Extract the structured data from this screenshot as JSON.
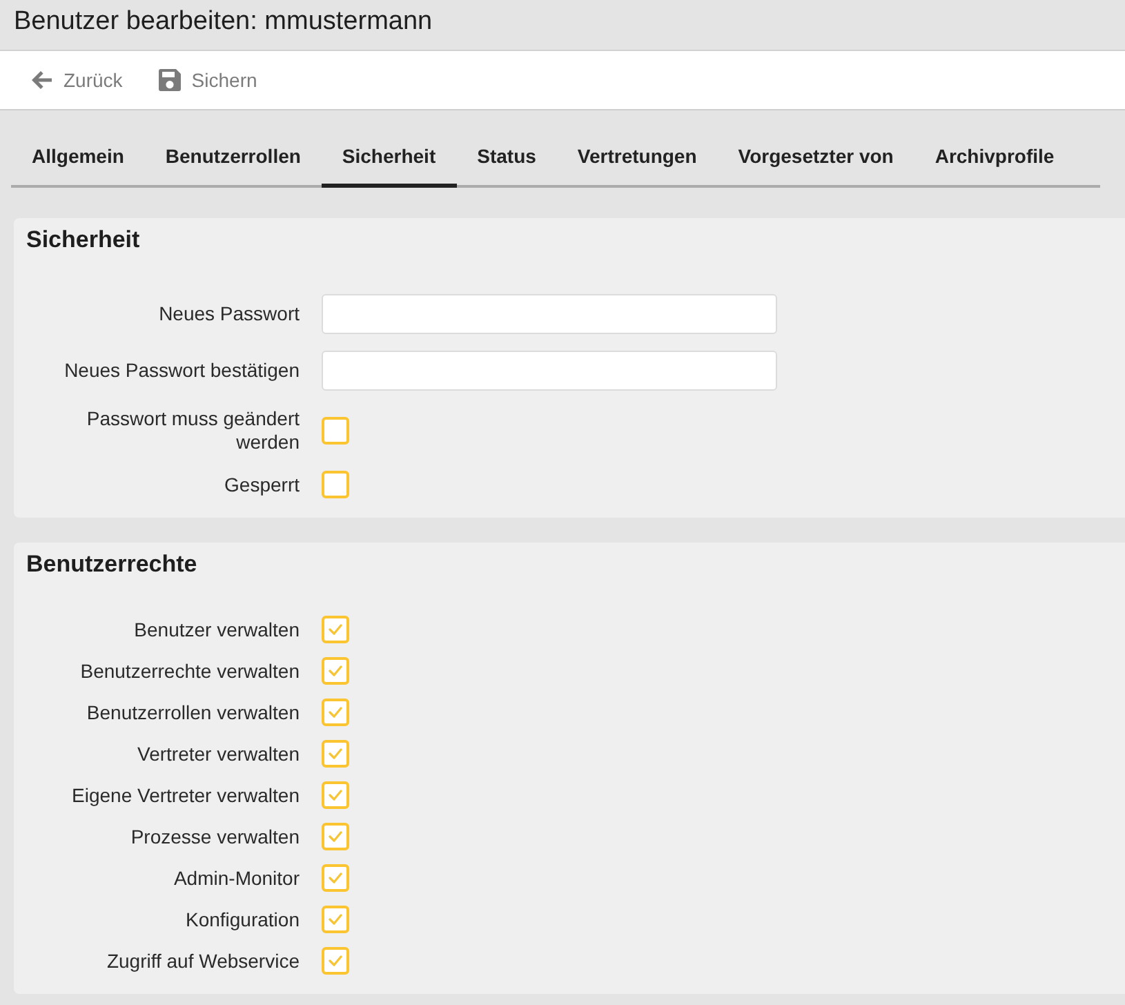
{
  "page_title": "Benutzer bearbeiten: mmustermann",
  "toolbar": [
    {
      "kind": "back",
      "label": "Zurück"
    },
    {
      "kind": "save",
      "label": "Sichern"
    }
  ],
  "tabs": [
    {
      "label": "Allgemein",
      "selected": false
    },
    {
      "label": "Benutzerrollen",
      "selected": false
    },
    {
      "label": "Sicherheit",
      "selected": true
    },
    {
      "label": "Status",
      "selected": false
    },
    {
      "label": "Vertretungen",
      "selected": false
    },
    {
      "label": "Vorgesetzter von",
      "selected": false
    },
    {
      "label": "Archivprofile",
      "selected": false
    }
  ],
  "sections": [
    {
      "title": "Sicherheit",
      "rows": [
        {
          "kind": "input",
          "label": "Neues Passwort"
        },
        {
          "kind": "input",
          "label": "Neues Passwort bestätigen"
        },
        {
          "kind": "checkbox",
          "label": "Passwort muss geändert werden",
          "checked": false
        },
        {
          "kind": "checkbox",
          "label": "Gesperrt",
          "checked": false
        }
      ]
    },
    {
      "title": "Benutzerrechte",
      "rows": [
        {
          "kind": "checkbox",
          "label": "Benutzer verwalten",
          "checked": true
        },
        {
          "kind": "checkbox",
          "label": "Benutzerrechte verwalten",
          "checked": true
        },
        {
          "kind": "checkbox",
          "label": "Benutzerrollen verwalten",
          "checked": true
        },
        {
          "kind": "checkbox",
          "label": "Vertreter verwalten",
          "checked": true
        },
        {
          "kind": "checkbox",
          "label": "Eigene Vertreter verwalten",
          "checked": true
        },
        {
          "kind": "checkbox",
          "label": "Prozesse verwalten",
          "checked": true
        },
        {
          "kind": "checkbox",
          "label": "Admin-Monitor",
          "checked": true
        },
        {
          "kind": "checkbox",
          "label": "Konfiguration",
          "checked": true
        },
        {
          "kind": "checkbox",
          "label": "Zugriff auf Webservice",
          "checked": true
        }
      ]
    }
  ]
}
